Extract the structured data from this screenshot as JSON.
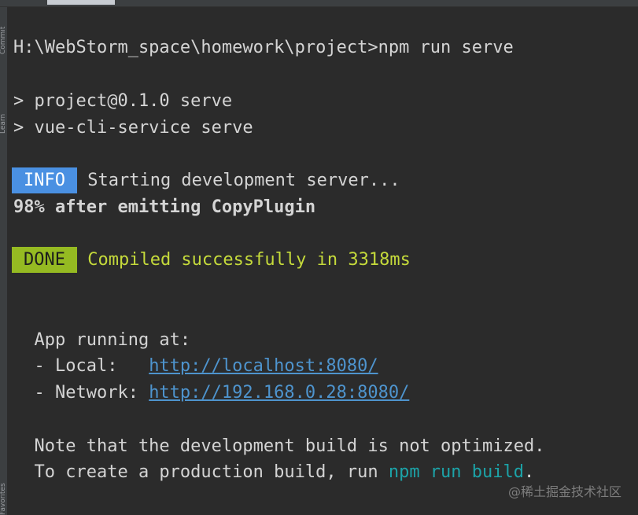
{
  "sidebar": {
    "commit_label": "Commit",
    "learn_label": "Learn",
    "favorites_label": "Favorites"
  },
  "terminal": {
    "command_line": "H:\\WebStorm_space\\homework\\project>npm run serve",
    "script_line_1": "> project@0.1.0 serve",
    "script_line_2": "> vue-cli-service serve",
    "info_badge": "INFO",
    "info_text": " Starting development server...",
    "progress_text": "98% after emitting CopyPlugin",
    "done_badge": "DONE",
    "done_text": " Compiled successfully in 3318ms",
    "app_running": "  App running at:",
    "local_label": "  - Local:   ",
    "local_url": "http://localhost:8080/",
    "network_label": "  - Network: ",
    "network_url": "http://192.168.0.28:8080/",
    "note_line_1": "  Note that the development build is not optimized.",
    "note_line_2_prefix": "  To create a production build, run ",
    "note_line_2_cmd": "npm run build",
    "note_line_2_suffix": "."
  },
  "watermark": "@稀土掘金技术社区",
  "colors": {
    "background": "#2b2b2b",
    "info_badge": "#4a90e2",
    "done_badge": "#95ba22",
    "done_text": "#c5da3b",
    "link": "#4e94ce",
    "command_highlight": "#1ca3a8"
  }
}
